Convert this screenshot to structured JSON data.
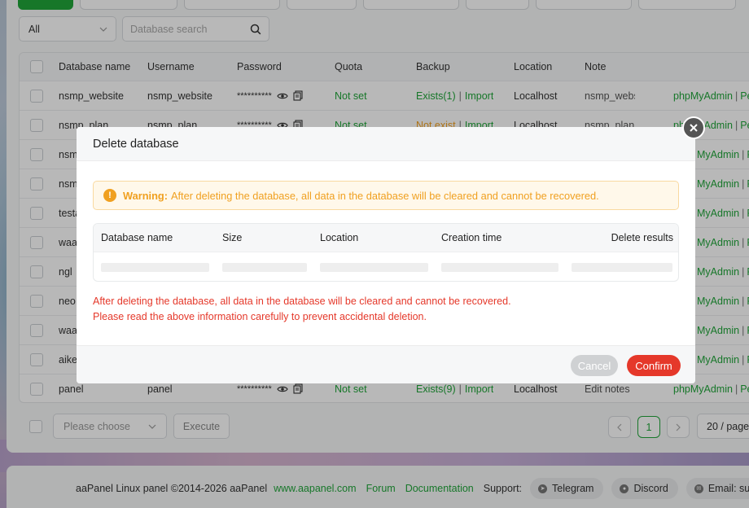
{
  "filter": {
    "selected": "All"
  },
  "search": {
    "placeholder": "Database search"
  },
  "table": {
    "headers": [
      "Database name",
      "Username",
      "Password",
      "Quota",
      "Backup",
      "Location",
      "Note"
    ],
    "rows": [
      {
        "name": "nsmp_website",
        "user": "nsmp_website",
        "password": "**********",
        "quota": "Not set",
        "backup_status": "Exists(1)",
        "backup_status_type": "exists",
        "import": "Import",
        "location": "Localhost",
        "note": "nsmp_webs",
        "actions": [
          "phpMyAdmin",
          "Pe"
        ]
      },
      {
        "name": "nsmp_plan",
        "user": "nsmp_plan",
        "password": "**********",
        "quota": "Not set",
        "backup_status": "Not exist",
        "backup_status_type": "missing",
        "import": "Import",
        "location": "Localhost",
        "note": "nsmp_plan",
        "actions": [
          "phpMyAdmin",
          "Pe"
        ]
      },
      {
        "name": "nsm",
        "user": "",
        "password": "",
        "quota": "",
        "backup_status": "",
        "import": "",
        "location": "",
        "note": "",
        "actions": [
          "MyAdmin",
          "Pe"
        ]
      },
      {
        "name": "nsm",
        "user": "",
        "password": "",
        "quota": "",
        "backup_status": "",
        "import": "",
        "location": "",
        "note": "",
        "actions": [
          "MyAdmin",
          "Pe"
        ]
      },
      {
        "name": "testa",
        "user": "",
        "password": "",
        "quota": "",
        "backup_status": "",
        "import": "",
        "location": "",
        "note": "",
        "actions": [
          "MyAdmin",
          "Pe"
        ]
      },
      {
        "name": "waa",
        "user": "",
        "password": "",
        "quota": "",
        "backup_status": "",
        "import": "",
        "location": "",
        "note": "",
        "actions": [
          "MyAdmin",
          "Pe"
        ]
      },
      {
        "name": "ngl",
        "user": "",
        "password": "",
        "quota": "",
        "backup_status": "",
        "import": "",
        "location": "",
        "note": "",
        "actions": [
          "MyAdmin",
          "Pe"
        ]
      },
      {
        "name": "neo:",
        "user": "",
        "password": "",
        "quota": "",
        "backup_status": "",
        "import": "",
        "location": "",
        "note": "",
        "actions": [
          "MyAdmin",
          "Pe"
        ]
      },
      {
        "name": "waa",
        "user": "",
        "password": "",
        "quota": "",
        "backup_status": "",
        "import": "",
        "location": "",
        "note": "",
        "actions": [
          "MyAdmin",
          "Pe"
        ]
      },
      {
        "name": "aike",
        "user": "",
        "password": "",
        "quota": "",
        "backup_status": "",
        "import": "",
        "location": "",
        "note": "",
        "actions": [
          "MyAdmin",
          "Pe"
        ]
      },
      {
        "name": "panel",
        "user": "panel",
        "password": "**********",
        "quota": "Not set",
        "backup_status": "Exists(9)",
        "backup_status_type": "exists",
        "import": "Import",
        "location": "Localhost",
        "note": "Edit notes",
        "actions": [
          "phpMyAdmin",
          "Pe"
        ]
      }
    ]
  },
  "bulk": {
    "choose_placeholder": "Please choose",
    "execute_label": "Execute"
  },
  "pagination": {
    "current": "1",
    "per_page": "20 / page"
  },
  "footer": {
    "copyright": "aaPanel Linux panel ©2014-2026 aaPanel",
    "site_link": "www.aapanel.com",
    "forum": "Forum",
    "documentation": "Documentation",
    "support_label": "Support:",
    "telegram": "Telegram",
    "discord": "Discord",
    "email": "Email: su"
  },
  "modal": {
    "title": "Delete database",
    "warning_label": "Warning:",
    "warning_text": "After deleting the database, all data in the database will be cleared and cannot be recovered.",
    "columns": [
      "Database name",
      "Size",
      "Location",
      "Creation time",
      "Delete results"
    ],
    "red_line1": "After deleting the database, all data in the database will be cleared and cannot be recovered.",
    "red_line2": "Please read the above information carefully to prevent accidental deletion.",
    "cancel_label": "Cancel",
    "confirm_label": "Confirm"
  },
  "colors": {
    "accent": "#20a53a",
    "warning": "#f0a020",
    "danger": "#e5382a"
  }
}
